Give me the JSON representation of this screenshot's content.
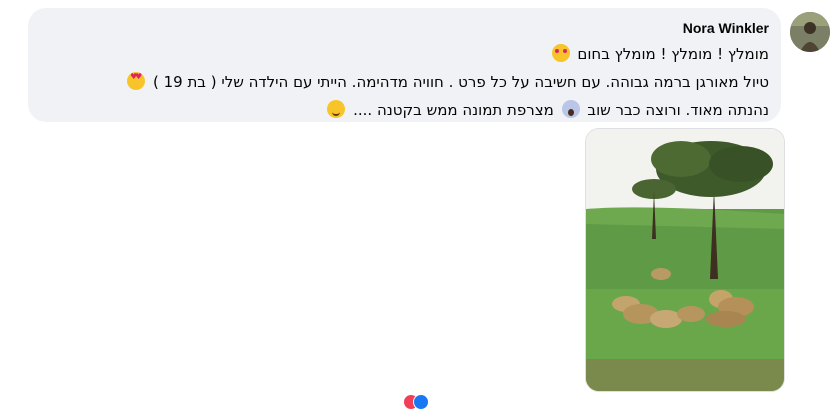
{
  "comment": {
    "author": "Nora Winkler",
    "lines": [
      "מומלץ ! מומלץ ! מומלץ בחום",
      "טיול מאורגן ברמה גבוהה. עם חשיבה על כל פרט . חוויה מדהימה. הייתי עם הילדה שלי ( בת 19 )",
      "נהנתה מאוד. ורוצה כבר שוב",
      "מצרפת תמונה ממש בקטנה ...."
    ],
    "emojis": [
      "smiling-face-with-hearts",
      "heart-eyes",
      "screaming-face",
      "winking-face"
    ]
  },
  "photo": {
    "subject": "lions-under-acacia-tree"
  },
  "reactions": {
    "colors": [
      "#f33e58",
      "#1877f2"
    ]
  }
}
